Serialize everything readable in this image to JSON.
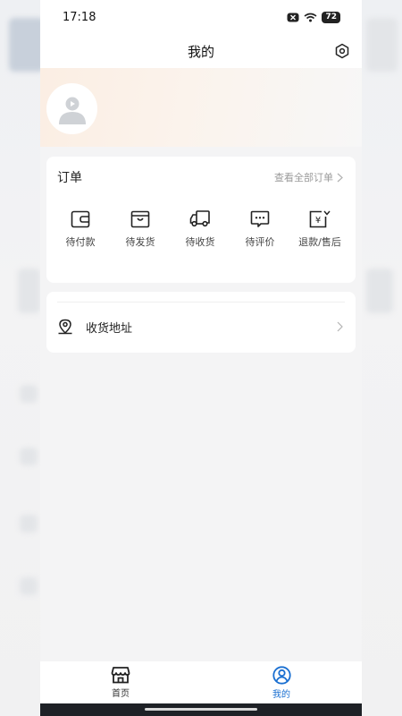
{
  "status_bar": {
    "time": "17:18",
    "battery": "72"
  },
  "header": {
    "title": "我的"
  },
  "orders": {
    "title": "订单",
    "view_all": "查看全部订单",
    "items": [
      {
        "label": "待付款",
        "icon": "wallet-icon"
      },
      {
        "label": "待发货",
        "icon": "box-icon"
      },
      {
        "label": "待收货",
        "icon": "truck-icon"
      },
      {
        "label": "待评价",
        "icon": "comment-icon"
      },
      {
        "label": "退款/售后",
        "icon": "refund-icon"
      }
    ]
  },
  "address": {
    "label": "收货地址",
    "icon": "location-icon"
  },
  "tabbar": {
    "tabs": [
      {
        "label": "首页",
        "icon": "store-icon",
        "active": false
      },
      {
        "label": "我的",
        "icon": "user-circle-icon",
        "active": true
      }
    ]
  },
  "colors": {
    "accent": "#1a6fd1",
    "profile_bg": "#fbeee3",
    "page_bg": "#f4f4f5"
  }
}
